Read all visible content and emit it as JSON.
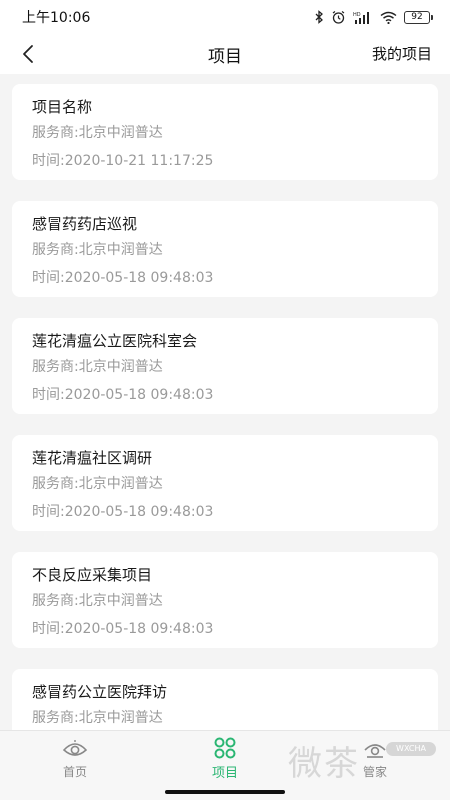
{
  "status_bar": {
    "time": "上午10:06",
    "battery": "92",
    "network_label": "HD"
  },
  "header": {
    "title": "项目",
    "right_action": "我的项目",
    "back_icon": "chevron-left-icon"
  },
  "projects": [
    {
      "title": "项目名称",
      "provider": "服务商:北京中润普达",
      "time": "时间:2020-10-21 11:17:25"
    },
    {
      "title": "感冒药药店巡视",
      "provider": "服务商:北京中润普达",
      "time": "时间:2020-05-18 09:48:03"
    },
    {
      "title": "莲花清瘟公立医院科室会",
      "provider": "服务商:北京中润普达",
      "time": "时间:2020-05-18 09:48:03"
    },
    {
      "title": "莲花清瘟社区调研",
      "provider": "服务商:北京中润普达",
      "time": "时间:2020-05-18 09:48:03"
    },
    {
      "title": "不良反应采集项目",
      "provider": "服务商:北京中润普达",
      "time": "时间:2020-05-18 09:48:03"
    },
    {
      "title": "感冒药公立医院拜访",
      "provider": "服务商:北京中润普达",
      "time": ""
    }
  ],
  "tabs": [
    {
      "label": "首页",
      "icon": "eye-icon",
      "active": false
    },
    {
      "label": "项目",
      "icon": "grid-circles-icon",
      "active": true
    },
    {
      "label": "管家",
      "icon": "butler-icon",
      "active": false
    }
  ],
  "watermark": {
    "text": "微茶",
    "tag": "WXCHA"
  },
  "colors": {
    "accent": "#2bb673",
    "background": "#f4f4f4",
    "meta_text": "#9a9a9a"
  }
}
